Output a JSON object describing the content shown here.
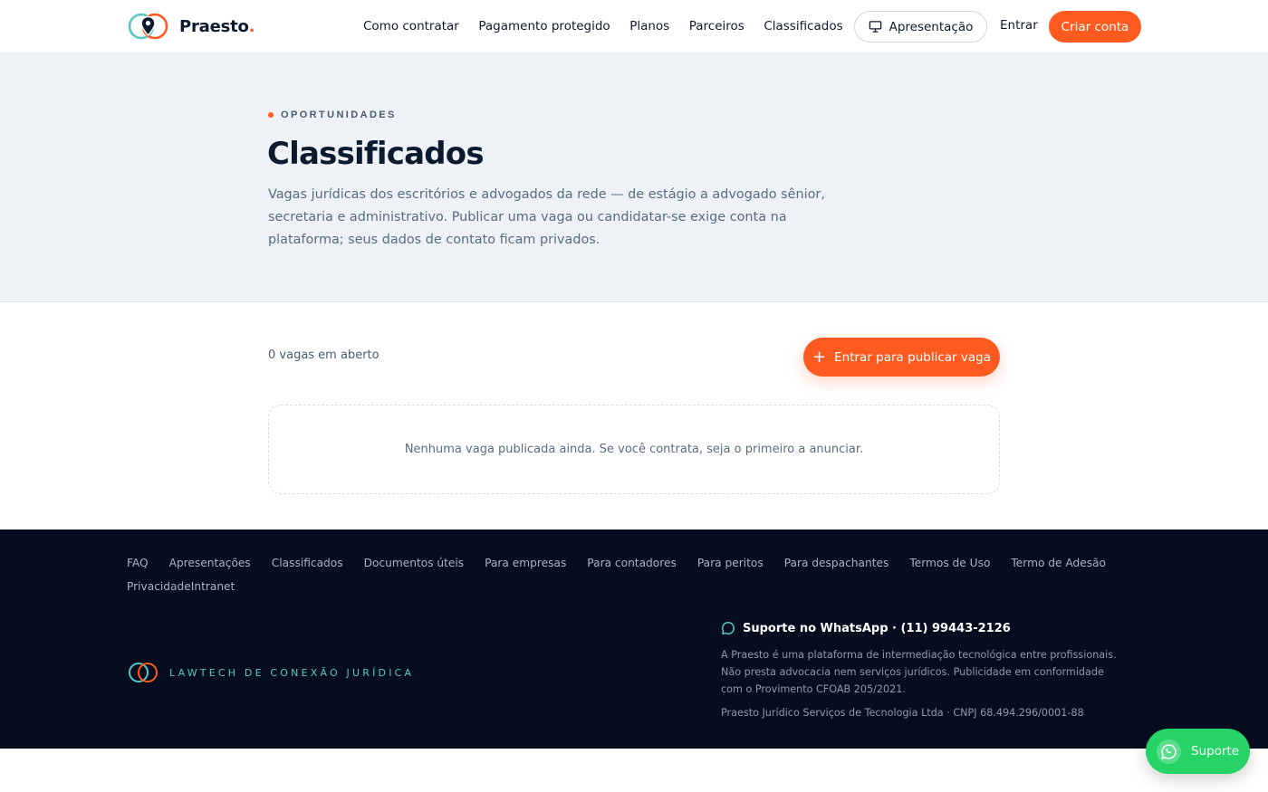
{
  "header": {
    "brand": "Praesto",
    "brand_dot": ".",
    "nav": [
      "Como contratar",
      "Pagamento protegido",
      "Planos",
      "Parceiros",
      "Classificados"
    ],
    "presentation_label": "Apresentação",
    "login_label": "Entrar",
    "signup_label": "Criar conta"
  },
  "hero": {
    "eyebrow": "OPORTUNIDADES",
    "title": "Classificados",
    "lead": "Vagas jurídicas dos escritórios e advogados da rede — de estágio a advogado sênior, secretaria e administrativo. Publicar uma vaga ou candidatar-se exige conta na plataforma; seus dados de contato ficam privados."
  },
  "main": {
    "count_text": "0 vagas em aberto",
    "publish_label": "Entrar para publicar vaga",
    "empty_text": "Nenhuma vaga publicada ainda. Se você contrata, seja o primeiro a anunciar."
  },
  "footer": {
    "links": [
      "FAQ",
      "Apresentações",
      "Classificados",
      "Documentos úteis",
      "Para empresas",
      "Para contadores",
      "Para peritos",
      "Para despachantes",
      "Termos de Uso",
      "Termo de Adesão",
      "Privacidade",
      "Intranet"
    ],
    "tagline": "LAWTECH DE CONEXÃO JURÍDICA",
    "support": "Suporte no WhatsApp · (11) 99443-2126",
    "disclaimer": "A Praesto é uma plataforma de intermediação tecnológica entre profissionais. Não presta advocacia nem serviços jurídicos. Publicidade em conformidade com o Provimento CFOAB 205/2021.",
    "company": "Praesto Jurídico Serviços de Tecnologia Ltda · CNPJ 68.494.296/0001-88"
  },
  "floating": {
    "whatsapp_label": "Suporte"
  },
  "colors": {
    "accent": "#ff5a1f",
    "teal": "#5bc7c4",
    "footer_bg": "#050d1f",
    "hero_bg": "#eef2f7",
    "whatsapp": "#25d366"
  },
  "icons": {
    "logo": "location-pin-rings-icon",
    "presentation": "presentation-board-icon",
    "plus": "plus-icon",
    "chat": "chat-bubble-icon",
    "whatsapp": "whatsapp-icon"
  }
}
